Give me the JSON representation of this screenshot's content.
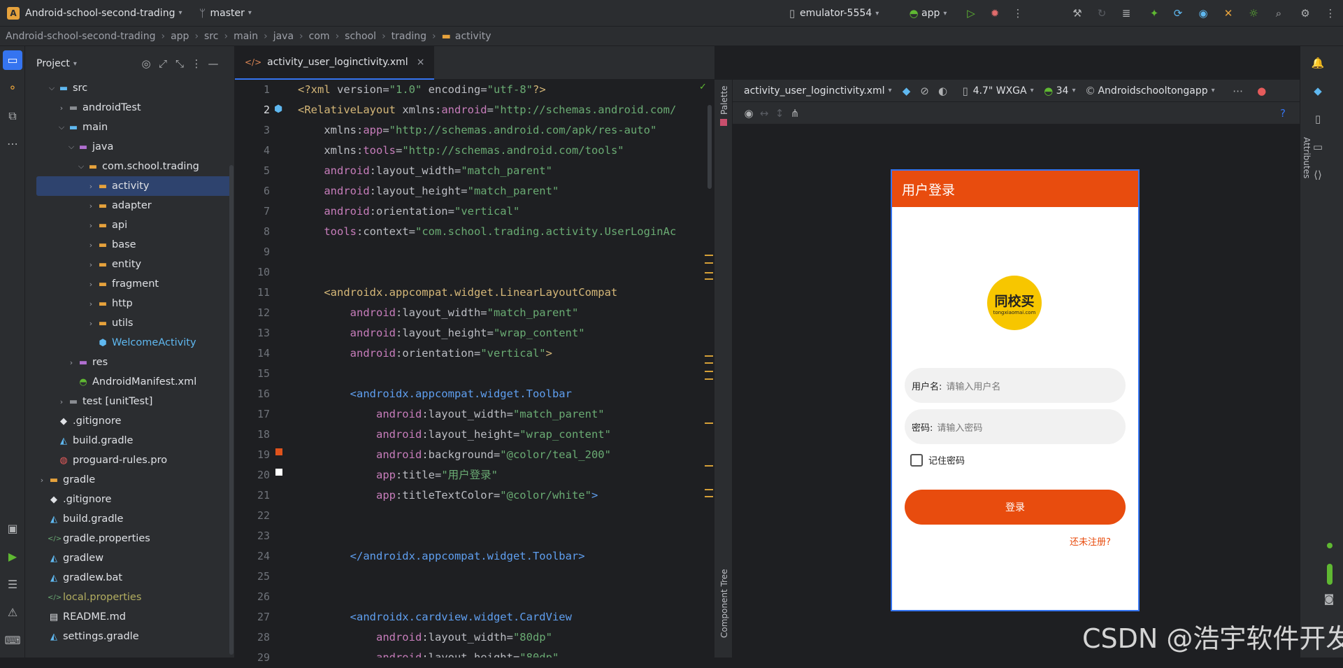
{
  "titlebar": {
    "app_letter": "A",
    "project": "Android-school-second-trading",
    "branch": "master",
    "device": "emulator-5554",
    "run_config": "app"
  },
  "breadcrumb": [
    "Android-school-second-trading",
    "app",
    "src",
    "main",
    "java",
    "com",
    "school",
    "trading",
    "activity"
  ],
  "project_panel": {
    "title": "Project",
    "rows": [
      {
        "label": "src",
        "depth": 2,
        "arrow": "v",
        "icon": "folder-src-icon",
        "selected": false,
        "color": "#dfe1e5"
      },
      {
        "label": "androidTest",
        "depth": 3,
        "arrow": ">",
        "icon": "folder-test-icon",
        "selected": false,
        "color": "#dfe1e5"
      },
      {
        "label": "main",
        "depth": 3,
        "arrow": "v",
        "icon": "folder-main-icon",
        "selected": false,
        "color": "#dfe1e5"
      },
      {
        "label": "java",
        "depth": 4,
        "arrow": "v",
        "icon": "folder-java-icon",
        "selected": false,
        "color": "#dfe1e5"
      },
      {
        "label": "com.school.trading",
        "depth": 5,
        "arrow": "v",
        "icon": "package-icon",
        "selected": false,
        "color": "#dfe1e5"
      },
      {
        "label": "activity",
        "depth": 6,
        "arrow": ">",
        "icon": "folder-icon",
        "selected": true,
        "color": "#dfe1e5"
      },
      {
        "label": "adapter",
        "depth": 6,
        "arrow": ">",
        "icon": "folder-icon",
        "selected": false,
        "color": "#dfe1e5"
      },
      {
        "label": "api",
        "depth": 6,
        "arrow": ">",
        "icon": "folder-icon",
        "selected": false,
        "color": "#dfe1e5"
      },
      {
        "label": "base",
        "depth": 6,
        "arrow": ">",
        "icon": "folder-icon",
        "selected": false,
        "color": "#dfe1e5"
      },
      {
        "label": "entity",
        "depth": 6,
        "arrow": ">",
        "icon": "folder-icon",
        "selected": false,
        "color": "#dfe1e5"
      },
      {
        "label": "fragment",
        "depth": 6,
        "arrow": ">",
        "icon": "folder-icon",
        "selected": false,
        "color": "#dfe1e5"
      },
      {
        "label": "http",
        "depth": 6,
        "arrow": ">",
        "icon": "folder-icon",
        "selected": false,
        "color": "#dfe1e5"
      },
      {
        "label": "utils",
        "depth": 6,
        "arrow": ">",
        "icon": "folder-icon",
        "selected": false,
        "color": "#dfe1e5"
      },
      {
        "label": "WelcomeActivity",
        "depth": 6,
        "arrow": "",
        "icon": "class-icon",
        "selected": false,
        "color": "#5fb8f0"
      },
      {
        "label": "res",
        "depth": 4,
        "arrow": ">",
        "icon": "folder-res-icon",
        "selected": false,
        "color": "#dfe1e5"
      },
      {
        "label": "AndroidManifest.xml",
        "depth": 4,
        "arrow": "",
        "icon": "android-icon",
        "selected": false,
        "color": "#dfe1e5"
      },
      {
        "label": "test [unitTest]",
        "depth": 3,
        "arrow": ">",
        "icon": "folder-test-icon",
        "selected": false,
        "color": "#dfe1e5"
      },
      {
        "label": ".gitignore",
        "depth": 2,
        "arrow": "",
        "icon": "git-icon",
        "selected": false,
        "color": "#dfe1e5"
      },
      {
        "label": "build.gradle",
        "depth": 2,
        "arrow": "",
        "icon": "gradle-icon",
        "selected": false,
        "color": "#dfe1e5"
      },
      {
        "label": "proguard-rules.pro",
        "depth": 2,
        "arrow": "",
        "icon": "proguard-icon",
        "selected": false,
        "color": "#dfe1e5"
      },
      {
        "label": "gradle",
        "depth": 1,
        "arrow": ">",
        "icon": "folder-icon",
        "selected": false,
        "color": "#dfe1e5"
      },
      {
        "label": ".gitignore",
        "depth": 1,
        "arrow": "",
        "icon": "git-icon",
        "selected": false,
        "color": "#dfe1e5"
      },
      {
        "label": "build.gradle",
        "depth": 1,
        "arrow": "",
        "icon": "gradle-icon",
        "selected": false,
        "color": "#dfe1e5"
      },
      {
        "label": "gradle.properties",
        "depth": 1,
        "arrow": "",
        "icon": "properties-icon",
        "selected": false,
        "color": "#dfe1e5"
      },
      {
        "label": "gradlew",
        "depth": 1,
        "arrow": "",
        "icon": "gradle-icon",
        "selected": false,
        "color": "#dfe1e5"
      },
      {
        "label": "gradlew.bat",
        "depth": 1,
        "arrow": "",
        "icon": "gradle-icon",
        "selected": false,
        "color": "#dfe1e5"
      },
      {
        "label": "local.properties",
        "depth": 1,
        "arrow": "",
        "icon": "properties-icon",
        "selected": false,
        "color": "#b3ae60"
      },
      {
        "label": "README.md",
        "depth": 1,
        "arrow": "",
        "icon": "markdown-icon",
        "selected": false,
        "color": "#dfe1e5"
      },
      {
        "label": "settings.gradle",
        "depth": 1,
        "arrow": "",
        "icon": "gradle-icon",
        "selected": false,
        "color": "#dfe1e5"
      }
    ]
  },
  "editor": {
    "tab": "activity_user_loginctivity.xml",
    "lines": [
      [
        [
          "tag",
          "<?xml "
        ],
        [
          "atn",
          "version="
        ],
        [
          "str",
          "\"1.0\""
        ],
        [
          "atn",
          " encoding="
        ],
        [
          "str",
          "\"utf-8\""
        ],
        [
          "tag",
          "?>"
        ]
      ],
      [
        [
          "tag",
          "<RelativeLayout "
        ],
        [
          "atn",
          "xmlns:"
        ],
        [
          "ns",
          "android"
        ],
        [
          "atn",
          "="
        ],
        [
          "str",
          "\"http://schemas.android.com/"
        ]
      ],
      [
        [
          "atn",
          "    xmlns:"
        ],
        [
          "ns",
          "app"
        ],
        [
          "atn",
          "="
        ],
        [
          "str",
          "\"http://schemas.android.com/apk/res-auto\""
        ]
      ],
      [
        [
          "atn",
          "    xmlns:"
        ],
        [
          "ns",
          "tools"
        ],
        [
          "atn",
          "="
        ],
        [
          "str",
          "\"http://schemas.android.com/tools\""
        ]
      ],
      [
        [
          "ns",
          "    android"
        ],
        [
          "atn",
          ":layout_width="
        ],
        [
          "str",
          "\"match_parent\""
        ]
      ],
      [
        [
          "ns",
          "    android"
        ],
        [
          "atn",
          ":layout_height="
        ],
        [
          "str",
          "\"match_parent\""
        ]
      ],
      [
        [
          "ns",
          "    android"
        ],
        [
          "atn",
          ":orientation="
        ],
        [
          "str",
          "\"vertical\""
        ]
      ],
      [
        [
          "ns",
          "    tools"
        ],
        [
          "atn",
          ":context="
        ],
        [
          "str",
          "\"com.school.trading.activity.UserLoginAc"
        ]
      ],
      [],
      [],
      [
        [
          "tag",
          "    <androidx.appcompat.widget.LinearLayoutCompat"
        ]
      ],
      [
        [
          "ns",
          "        android"
        ],
        [
          "atn",
          ":layout_width="
        ],
        [
          "str",
          "\"match_parent\""
        ]
      ],
      [
        [
          "ns",
          "        android"
        ],
        [
          "atn",
          ":layout_height="
        ],
        [
          "str",
          "\"wrap_content\""
        ]
      ],
      [
        [
          "ns",
          "        android"
        ],
        [
          "atn",
          ":orientation="
        ],
        [
          "str",
          "\"vertical\""
        ],
        [
          "tag",
          ">"
        ]
      ],
      [],
      [
        [
          "tagb",
          "        <androidx.appcompat.widget.Toolbar"
        ]
      ],
      [
        [
          "ns",
          "            android"
        ],
        [
          "atn",
          ":layout_width="
        ],
        [
          "str",
          "\"match_parent\""
        ]
      ],
      [
        [
          "ns",
          "            android"
        ],
        [
          "atn",
          ":layout_height="
        ],
        [
          "str",
          "\"wrap_content\""
        ]
      ],
      [
        [
          "ns",
          "            android"
        ],
        [
          "atn",
          ":background="
        ],
        [
          "str",
          "\"@color/teal_200\""
        ]
      ],
      [
        [
          "ns",
          "            app"
        ],
        [
          "atn",
          ":title="
        ],
        [
          "str",
          "\"用户登录\""
        ]
      ],
      [
        [
          "ns",
          "            app"
        ],
        [
          "atn",
          ":titleTextColor="
        ],
        [
          "str",
          "\"@color/white\""
        ],
        [
          "tagb",
          ">"
        ]
      ],
      [],
      [],
      [
        [
          "tagb",
          "        </androidx.appcompat.widget.Toolbar>"
        ]
      ],
      [],
      [],
      [
        [
          "tagb",
          "        <androidx.cardview.widget.CardView"
        ]
      ],
      [
        [
          "ns",
          "            android"
        ],
        [
          "atn",
          ":layout_width="
        ],
        [
          "str",
          "\"80dp\""
        ]
      ],
      [
        [
          "ns",
          "            android"
        ],
        [
          "atn",
          ":layout_height="
        ],
        [
          "str",
          "\"80dp\""
        ]
      ]
    ]
  },
  "design": {
    "file": "activity_user_loginctivity.xml",
    "device": "4.7\" WXGA",
    "api": "34",
    "theme": "Androidschooltongapp",
    "palette_label": "Palette",
    "component_tree_label": "Component Tree",
    "attributes_label": "Attributes"
  },
  "preview": {
    "toolbar_title": "用户登录",
    "logo_text": "同校买",
    "logo_sub": "tongxiaomai.com",
    "username_label": "用户名:",
    "username_placeholder": "请输入用户名",
    "password_label": "密码:",
    "password_placeholder": "请输入密码",
    "remember_label": "记住密码",
    "login_button": "登录",
    "register_link": "还未注册?"
  },
  "watermark": "CSDN @浩宇软件开发",
  "colors": {
    "accent": "#e84c0e",
    "selection": "#2e436e",
    "logo": "#f7c600"
  }
}
